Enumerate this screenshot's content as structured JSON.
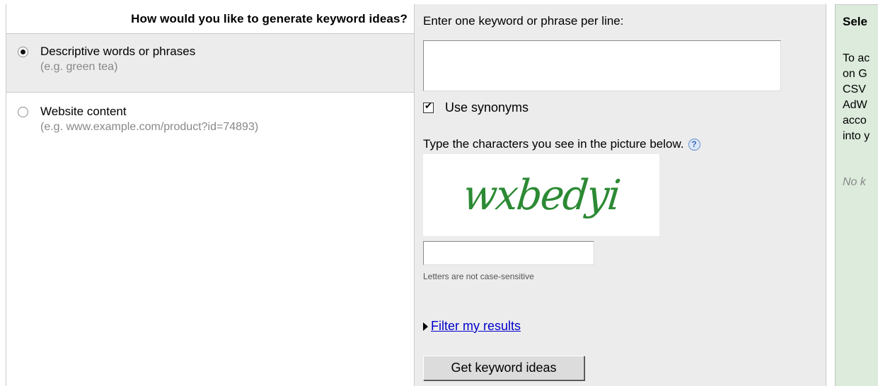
{
  "left": {
    "header": "How would you like to generate keyword ideas?",
    "options": [
      {
        "label": "Descriptive words or phrases",
        "example": "(e.g. green tea)",
        "selected": true
      },
      {
        "label": "Website content",
        "example": "(e.g. www.example.com/product?id=74893)",
        "selected": false
      }
    ]
  },
  "middle": {
    "keyword_prompt": "Enter one keyword or phrase per line:",
    "keyword_value": "",
    "synonyms_label": "Use synonyms",
    "synonyms_checked": true,
    "captcha_prompt": "Type the characters you see in the picture below.",
    "help_icon": "?",
    "captcha_text": "wxbedyi",
    "captcha_value": "",
    "captcha_hint": "Letters are not case-sensitive",
    "filter_link": "Filter my results",
    "submit_label": "Get keyword ideas",
    "captcha_color": "#2c8a34",
    "link_color": "#0000cc"
  },
  "right": {
    "title": "Sele",
    "body_lines": [
      "To ac",
      "on G",
      "CSV",
      "AdW",
      "acco",
      "into y"
    ],
    "empty_text": "No k",
    "background": "#dcebdc"
  }
}
